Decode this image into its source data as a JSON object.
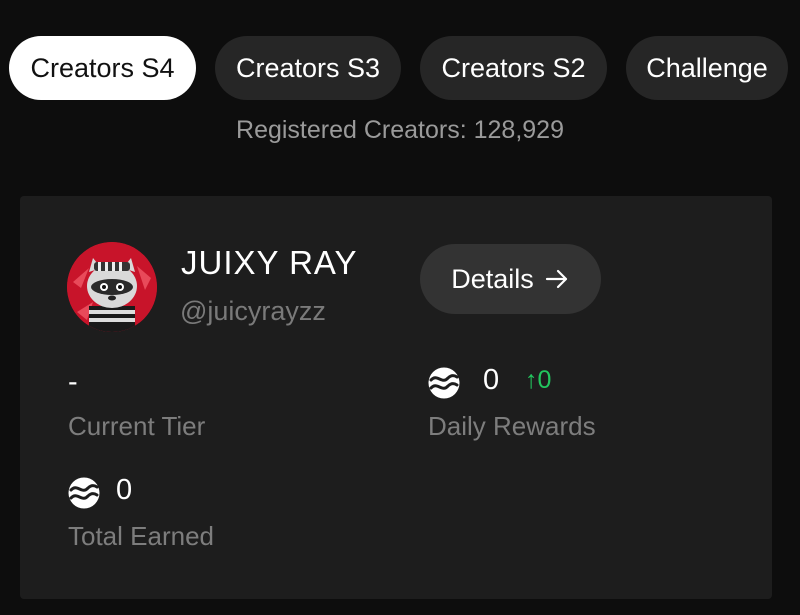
{
  "tabs": [
    {
      "label": "Creators S4",
      "active": true
    },
    {
      "label": "Creators S3",
      "active": false
    },
    {
      "label": "Creators S2",
      "active": false
    },
    {
      "label": "Challenge",
      "active": false
    }
  ],
  "registered_text": "Registered Creators: 128,929",
  "profile": {
    "name": "JUIXY RAY",
    "handle": "@juicyrayzz",
    "details_label": "Details",
    "details_icon": "arrow-right-icon"
  },
  "stats": {
    "current_tier": {
      "value": "-",
      "label": "Current Tier"
    },
    "daily_rewards": {
      "value": "0",
      "delta": "↑0",
      "label": "Daily Rewards",
      "icon": "coin-icon"
    },
    "total_earned": {
      "value": "0",
      "label": "Total Earned",
      "icon": "coin-icon"
    }
  },
  "colors": {
    "background": "#0d0d0d",
    "card": "#1d1d1d",
    "tab": "#262626",
    "tab_active": "#ffffff",
    "button": "#333333",
    "positive": "#22c55e",
    "avatar_bg": "#c8142a"
  }
}
